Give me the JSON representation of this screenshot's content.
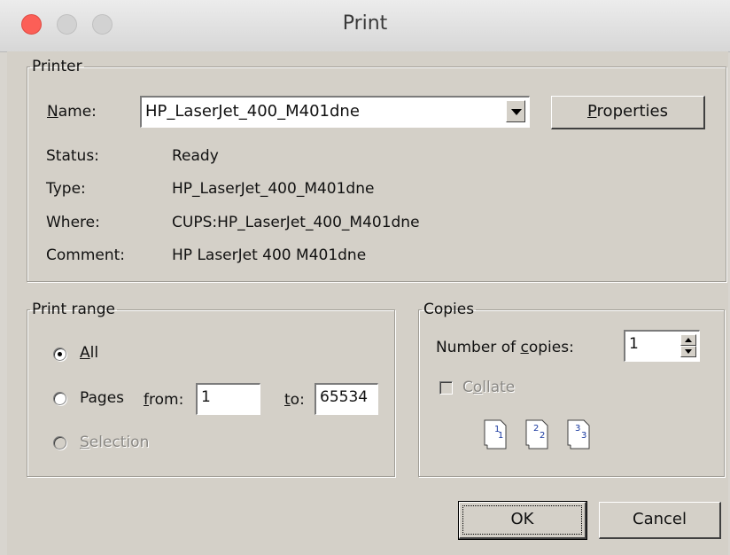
{
  "window": {
    "title": "Print"
  },
  "printer": {
    "legend": "Printer",
    "name_label_key": "N",
    "name_label_rest": "ame:",
    "selected_printer": "HP_LaserJet_400_M401dne",
    "properties_key": "P",
    "properties_rest": "roperties",
    "status_label": "Status:",
    "status_value": "Ready",
    "type_label": "Type:",
    "type_value": "HP_LaserJet_400_M401dne",
    "where_label": "Where:",
    "where_value": "CUPS:HP_LaserJet_400_M401dne",
    "comment_label": "Comment:",
    "comment_value": "HP LaserJet 400 M401dne"
  },
  "print_range": {
    "legend": "Print range",
    "all_key": "A",
    "all_rest": "ll",
    "pages_label": "Pages",
    "from_key": "f",
    "from_rest": "rom:",
    "from_value": "1",
    "to_key": "t",
    "to_rest": "o:",
    "to_value": "65534",
    "selection_key": "S",
    "selection_rest": "election",
    "selected": "All"
  },
  "copies": {
    "legend": "Copies",
    "number_label_pre": "Number of ",
    "number_label_key": "c",
    "number_label_post": "opies:",
    "number_value": "1",
    "collate_pre": "C",
    "collate_key": "o",
    "collate_post": "llate",
    "collate_checked": false,
    "collate_pages": [
      "1",
      "1",
      "2",
      "2",
      "3",
      "3"
    ]
  },
  "buttons": {
    "ok": "OK",
    "cancel": "Cancel"
  },
  "colors": {
    "close_light": "#fc5f57",
    "dialog_bg": "#d4d0c8"
  }
}
